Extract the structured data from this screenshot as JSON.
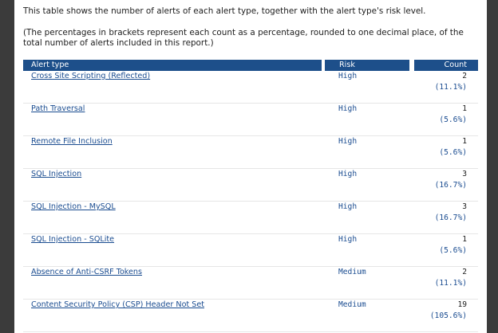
{
  "intro": {
    "line1": "This table shows the number of alerts of each alert type, together with the alert type's risk level.",
    "line2": "(The percentages in brackets represent each count as a percentage, rounded to one decimal place, of the total number of alerts included in this report.)"
  },
  "table": {
    "headers": {
      "type": "Alert type",
      "risk": "Risk",
      "count": "Count"
    },
    "rows": [
      {
        "name": "Cross Site Scripting (Reflected)",
        "risk": "High",
        "count": "2",
        "pct": "(11.1%)"
      },
      {
        "name": "Path Traversal",
        "risk": "High",
        "count": "1",
        "pct": "(5.6%)"
      },
      {
        "name": "Remote File Inclusion",
        "risk": "High",
        "count": "1",
        "pct": "(5.6%)"
      },
      {
        "name": "SQL Injection",
        "risk": "High",
        "count": "3",
        "pct": "(16.7%)"
      },
      {
        "name": "SQL Injection - MySQL",
        "risk": "High",
        "count": "3",
        "pct": "(16.7%)"
      },
      {
        "name": "SQL Injection - SQLite",
        "risk": "High",
        "count": "1",
        "pct": "(5.6%)"
      },
      {
        "name": "Absence of Anti-CSRF Tokens",
        "risk": "Medium",
        "count": "2",
        "pct": "(11.1%)"
      },
      {
        "name": "Content Security Policy (CSP) Header Not Set",
        "risk": "Medium",
        "count": "19",
        "pct": "(105.6%)"
      }
    ]
  },
  "colors": {
    "header_bg": "#1d4f8a",
    "link": "#1a4c90",
    "frame": "#3b3b3b"
  }
}
